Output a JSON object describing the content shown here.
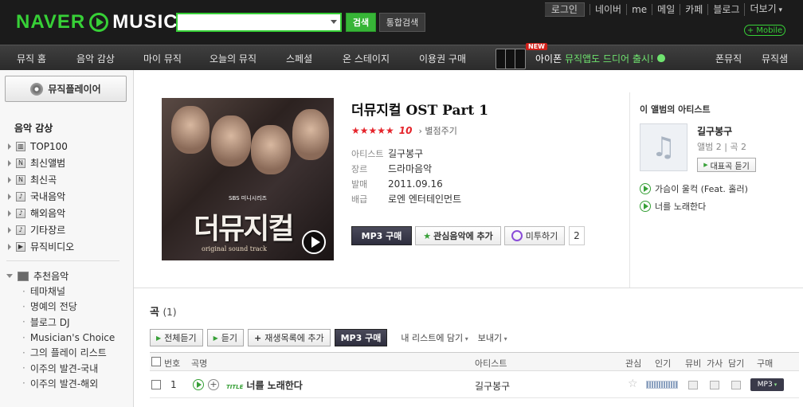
{
  "header": {
    "logo_naver": "NAVER",
    "logo_music": "MUSIC",
    "search_placeholder": "",
    "search_button": "검색",
    "total_search_button": "통합검색",
    "links": [
      "로그인",
      "네이버",
      "me",
      "메일",
      "카페",
      "블로그",
      "더보기"
    ],
    "mobile": "+ Mobile"
  },
  "nav": {
    "items": [
      "뮤직 홈",
      "음악 감상",
      "마이 뮤직",
      "오늘의 뮤직",
      "스페셜",
      "온 스테이지",
      "이용권 구매"
    ],
    "promo_new": "NEW",
    "promo_prefix": "아이폰",
    "promo_highlight": "뮤직앱도 드디어 출시!",
    "right_items": [
      "폰뮤직",
      "뮤직샘"
    ]
  },
  "sidebar": {
    "player_button": "뮤직플레이어",
    "section_title": "음악 감상",
    "items": [
      {
        "label": "TOP100",
        "icon": "chart-icon"
      },
      {
        "label": "최신앨범",
        "icon": "new-icon"
      },
      {
        "label": "최신곡",
        "icon": "new-icon"
      },
      {
        "label": "국내음악",
        "icon": "note-icon"
      },
      {
        "label": "해외음악",
        "icon": "note-icon"
      },
      {
        "label": "기타장르",
        "icon": "note-icon"
      },
      {
        "label": "뮤직비디오",
        "icon": "video-icon"
      }
    ],
    "recommend_title": "추천음악",
    "recommend_items": [
      "테마채널",
      "명예의 전당",
      "블로그 DJ",
      "Musician's Choice",
      "그의 플레이 리스트",
      "이주의 발견-국내",
      "이주의 발견-해외"
    ]
  },
  "album": {
    "title": "더뮤지컬 OST Part 1",
    "stars": "★★★★★",
    "score": "10",
    "rate_link": "별점주기",
    "meta": [
      {
        "key": "아티스트",
        "value": "길구봉구"
      },
      {
        "key": "장르",
        "value": "드라마음악"
      },
      {
        "key": "발매",
        "value": "2011.09.16"
      },
      {
        "key": "배급",
        "value": "로엔 엔터테인먼트"
      }
    ],
    "cover_brand": "SBS 미니시리즈",
    "cover_title": "더뮤지컬",
    "cover_sub": "original sound track",
    "buy_button": "MP3 구매",
    "fav_button": "관심음악에 추가",
    "me2_button": "미투하기",
    "me2_count": "2"
  },
  "artist_panel": {
    "title": "이 앨범의 아티스트",
    "name": "길구봉구",
    "stats": "앨범 2 | 곡 2",
    "top_button": "대표곡 듣기",
    "songs": [
      "가슴이 울컥 (Feat. 홀러)",
      "너를 노래한다"
    ]
  },
  "songs": {
    "title": "곡",
    "count": "(1)",
    "toolbar": {
      "play_all": "전체듣기",
      "play": "듣기",
      "add_playlist": "재생목록에 추가",
      "buy": "MP3 구매",
      "add_list": "내 리스트에 담기",
      "send": "보내기"
    },
    "columns": [
      "번호",
      "곡명",
      "아티스트",
      "관심",
      "인기",
      "뮤비",
      "가사",
      "담기",
      "구매"
    ],
    "rows": [
      {
        "no": "1",
        "badge": "TITLE",
        "title": "너를 노래한다",
        "artist": "길구봉구",
        "buy": "MP3"
      }
    ]
  }
}
